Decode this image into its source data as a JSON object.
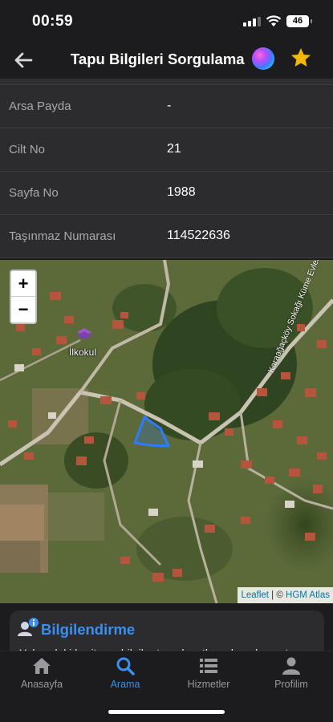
{
  "status_bar": {
    "time": "00:59",
    "battery": "46"
  },
  "header": {
    "title": "Tapu Bilgileri Sorgulama"
  },
  "rows": [
    {
      "label": "Arsa Payda",
      "value": "-"
    },
    {
      "label": "Cilt No",
      "value": "21"
    },
    {
      "label": "Sayfa No",
      "value": "1988"
    },
    {
      "label": "Taşınmaz Numarası",
      "value": "114522636"
    }
  ],
  "map": {
    "zoom_in": "+",
    "zoom_out": "−",
    "place_label": "İlkokul",
    "street_label": "Karaağaçköy Sokağı Küme Evleri",
    "attribution": {
      "leaflet": "Leaflet",
      "separator": " | © ",
      "source": "HGM Atlas"
    }
  },
  "info_card": {
    "title": "Bilgilendirme",
    "text": "Yukarıdaki harita ve bilgiler tapu kayıtlarından alınmıştır"
  },
  "tabs": [
    {
      "label": "Anasayfa",
      "icon": "home-icon"
    },
    {
      "label": "Arama",
      "icon": "search-icon",
      "active": true
    },
    {
      "label": "Hizmetler",
      "icon": "list-icon"
    },
    {
      "label": "Profilim",
      "icon": "person-icon"
    }
  ],
  "colors": {
    "accent": "#3a8ff0",
    "star": "#f5b800",
    "background": "#1c1c1e",
    "parcel": "#2f7bff"
  }
}
